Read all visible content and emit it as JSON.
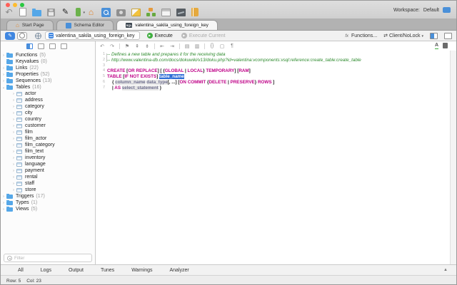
{
  "window": {
    "workspace_label": "Workspace:",
    "workspace_value": "Default"
  },
  "toolbar_icons": [
    "undo-icon",
    "new-document-icon",
    "open-folder-icon",
    "save-icon",
    "pen-icon",
    "server-icon",
    "home-icon",
    "search-icon",
    "camera-icon",
    "picture-icon",
    "diagram-icon",
    "window-icon",
    "chart-icon",
    "book-icon"
  ],
  "tabs": [
    {
      "label": "Start Page",
      "icon": "home-icon",
      "active": false
    },
    {
      "label": "Schema Editor",
      "icon": "schema-icon",
      "active": false
    },
    {
      "label": "valentina_sakila_using_foreign_key",
      "icon": "sql-icon",
      "active": true
    }
  ],
  "sqlbar": {
    "database_name": "valentina_sakila_using_foreign_key",
    "execute_label": "Execute",
    "execute_current_label": "Execute Current",
    "functions_label": "Functions...",
    "mode_label": "Client/NoLock"
  },
  "sidebar": {
    "view_icons": [
      "panel-view-1-icon",
      "panel-view-2-icon",
      "panel-view-3-icon",
      "panel-view-4-icon"
    ],
    "groups": [
      {
        "label": "Functions",
        "count": "(5)",
        "chev": "›",
        "children": []
      },
      {
        "label": "Keyvalues",
        "count": "(0)",
        "chev": "",
        "children": []
      },
      {
        "label": "Links",
        "count": "(22)",
        "chev": "›",
        "children": []
      },
      {
        "label": "Properties",
        "count": "(52)",
        "chev": "›",
        "children": []
      },
      {
        "label": "Sequences",
        "count": "(13)",
        "chev": "›",
        "children": []
      },
      {
        "label": "Tables",
        "count": "(16)",
        "chev": "⌄",
        "children": [
          "actor",
          "address",
          "category",
          "city",
          "country",
          "customer",
          "film",
          "film_actor",
          "film_category",
          "film_text",
          "inventory",
          "language",
          "payment",
          "rental",
          "staff",
          "store"
        ]
      },
      {
        "label": "Triggers",
        "count": "(17)",
        "chev": "›",
        "children": []
      },
      {
        "label": "Types",
        "count": "(1)",
        "chev": "›",
        "children": []
      },
      {
        "label": "Views",
        "count": "(5)",
        "chev": "›",
        "children": []
      }
    ],
    "filter_placeholder": "Filter"
  },
  "editor_toolbar_icons": [
    "undo-icon",
    "redo-icon",
    "sep",
    "bookmark-icon",
    "bookmark-prev-icon",
    "bookmark-next-icon",
    "sep",
    "outdent-icon",
    "indent-icon",
    "sep",
    "comment-icon",
    "uncomment-icon",
    "sep",
    "brackets-icon",
    "hint-icon",
    "format-icon"
  ],
  "editor": {
    "lines": [
      {
        "num": "1",
        "fold": "top",
        "segments": [
          {
            "t": "-- Defines a new table and prepares it for the receiving data",
            "c": "cm"
          }
        ]
      },
      {
        "num": "2",
        "fold": "bot",
        "segments": [
          {
            "t": "-- http://www.valentina-db.com/docs/dokuwiki/v13/doku.php?id=valentina:vcomponents:vsql:reference:create_table:create_table",
            "c": "cm"
          }
        ]
      },
      {
        "num": "3",
        "fold": "",
        "segments": []
      },
      {
        "num": "4",
        "fold": "",
        "segments": [
          {
            "t": "CREATE",
            "c": "kw"
          },
          {
            "t": " [",
            "c": "pl"
          },
          {
            "t": "OR REPLACE",
            "c": "kw"
          },
          {
            "t": "] [ {",
            "c": "pl"
          },
          {
            "t": "GLOBAL",
            "c": "kw"
          },
          {
            "t": " | ",
            "c": "pl"
          },
          {
            "t": "LOCAL",
            "c": "kw"
          },
          {
            "t": "} ",
            "c": "pl"
          },
          {
            "t": "TEMPORARY",
            "c": "kw"
          },
          {
            "t": "] [",
            "c": "pl"
          },
          {
            "t": "RAM",
            "c": "kw"
          },
          {
            "t": "]",
            "c": "pl"
          }
        ]
      },
      {
        "num": "5",
        "fold": "",
        "segments": [
          {
            "t": "TABLE",
            "c": "kw"
          },
          {
            "t": " [",
            "c": "pl"
          },
          {
            "t": "IF NOT EXISTS",
            "c": "kw"
          },
          {
            "t": "] ",
            "c": "pl"
          },
          {
            "t": "table_name",
            "c": "sel"
          }
        ]
      },
      {
        "num": "6",
        "fold": "",
        "segments": [
          {
            "t": "    { ",
            "c": "pl"
          },
          {
            "t": "column_name",
            "c": "idh"
          },
          {
            "t": " ",
            "c": "pl"
          },
          {
            "t": "data_type",
            "c": "idh"
          },
          {
            "t": "[, ...] [",
            "c": "pl"
          },
          {
            "t": "ON COMMIT",
            "c": "kw"
          },
          {
            "t": " {",
            "c": "pl"
          },
          {
            "t": "DELETE",
            "c": "kw"
          },
          {
            "t": " | ",
            "c": "pl"
          },
          {
            "t": "PRESERVE",
            "c": "kw"
          },
          {
            "t": "} ",
            "c": "pl"
          },
          {
            "t": "ROWS",
            "c": "kw"
          },
          {
            "t": " ]",
            "c": "pl"
          }
        ]
      },
      {
        "num": "7",
        "fold": "",
        "segments": [
          {
            "t": "    | ",
            "c": "pl"
          },
          {
            "t": "AS",
            "c": "kw"
          },
          {
            "t": " ",
            "c": "pl"
          },
          {
            "t": "select_statement",
            "c": "idh"
          },
          {
            "t": " }",
            "c": "pl"
          }
        ]
      }
    ]
  },
  "bottom": {
    "tabs": [
      "All",
      "Logs",
      "Output",
      "Tunes",
      "Warnings",
      "Analyzer"
    ],
    "status_row": "Row: 5",
    "status_col": "Col: 23"
  }
}
